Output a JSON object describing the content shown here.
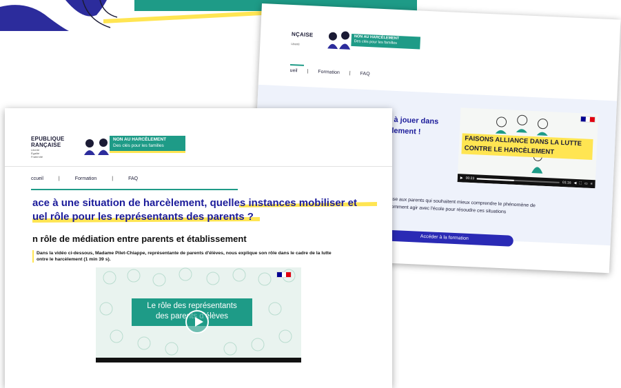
{
  "colors": {
    "teal": "#1e9b87",
    "navy": "#1b1b9a",
    "yellow": "#ffe552",
    "panel": "#eef2fb",
    "button": "#2a2ab5"
  },
  "brand": {
    "republic_line1": "RÉPUBLIQUE",
    "republic_line2": "FRANÇAISE",
    "republic_line1_crop": "EPUBLIQUE",
    "republic_line2_crop": "RANÇAISE",
    "back_line": "NÇAISE",
    "motto_lines": [
      "Liberté",
      "Égalité",
      "Fraternité"
    ],
    "site_title": "NON AU HARCÈLEMENT",
    "site_subtitle": "Des clés pour les familles"
  },
  "back_card": {
    "nav": [
      "ueil",
      "Formation",
      "FAQ"
    ],
    "headline": "ôle à jouer dans\nrcèlement !",
    "description": "s'adresse aux parents qui souhaitent mieux comprendre le phénomène de\navoir comment agir avec l'école pour résoudre ces situations",
    "button_label": "Accéder à la formation",
    "video": {
      "title": "FAISONS ALLIANCE DANS LA LUTTE CONTRE LE HARCÈLEMENT",
      "time_current": "00:23",
      "time_total": "01:16",
      "progress": 0.45
    }
  },
  "front_card": {
    "nav": [
      "ccueil",
      "Formation",
      "FAQ"
    ],
    "page_title": "ace à une situation de harcèlement, quelles instances mobiliser et\nuel rôle pour les représentants des parents ?",
    "section_title": "n rôle de médiation entre parents et établissement",
    "body_text": "Dans la vidéo ci-dessous, Madame Pilet-Chiappe, représentante de parents d'élèves, nous explique son rôle dans le cadre de la lutte\nontre le harcèlement (1 min 39 s).",
    "video": {
      "title_line1": "Le rôle des représentants",
      "title_line2": "des parents d'élèves"
    }
  }
}
